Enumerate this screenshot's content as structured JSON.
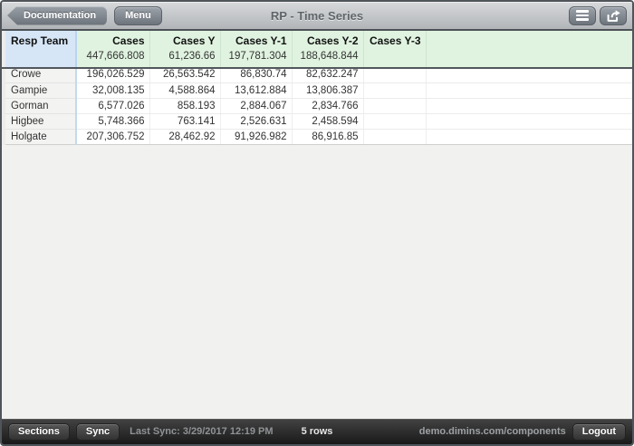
{
  "titlebar": {
    "title": "RP - Time Series",
    "documentation_label": "Documentation",
    "menu_label": "Menu",
    "icons": {
      "list_button": "hamburger-menu",
      "export_button": "share-arrow-box"
    }
  },
  "table": {
    "dimension_header": "Resp Team",
    "columns": [
      "Cases",
      "Cases Y",
      "Cases Y-1",
      "Cases Y-2",
      "Cases Y-3"
    ],
    "totals": [
      "447,666.808",
      "61,236.66",
      "197,781.304",
      "188,648.844",
      ""
    ],
    "rows": [
      {
        "team": "Crowe",
        "values": [
          "196,026.529",
          "26,563.542",
          "86,830.74",
          "82,632.247",
          ""
        ]
      },
      {
        "team": "Gampie",
        "values": [
          "32,008.135",
          "4,588.864",
          "13,612.884",
          "13,806.387",
          ""
        ]
      },
      {
        "team": "Gorman",
        "values": [
          "6,577.026",
          "858.193",
          "2,884.067",
          "2,834.766",
          ""
        ]
      },
      {
        "team": "Higbee",
        "values": [
          "5,748.366",
          "763.141",
          "2,526.631",
          "2,458.594",
          ""
        ]
      },
      {
        "team": "Holgate",
        "values": [
          "207,306.752",
          "28,462.92",
          "91,926.982",
          "86,916.85",
          ""
        ]
      }
    ]
  },
  "statusbar": {
    "sections_label": "Sections",
    "sync_label": "Sync",
    "last_sync": "Last Sync: 3/29/2017 12:19 PM",
    "row_count": "5 rows",
    "server": "demo.dimins.com/components",
    "logout_label": "Logout"
  },
  "colors": {
    "dimension_header_bg": "#d6e6f7",
    "measure_header_bg": "#e0f3e0",
    "column_divider_blue": "#c3d9ee",
    "table_frame_dark": "#4c5156",
    "statusbar_bg": "#2b2b2b"
  }
}
